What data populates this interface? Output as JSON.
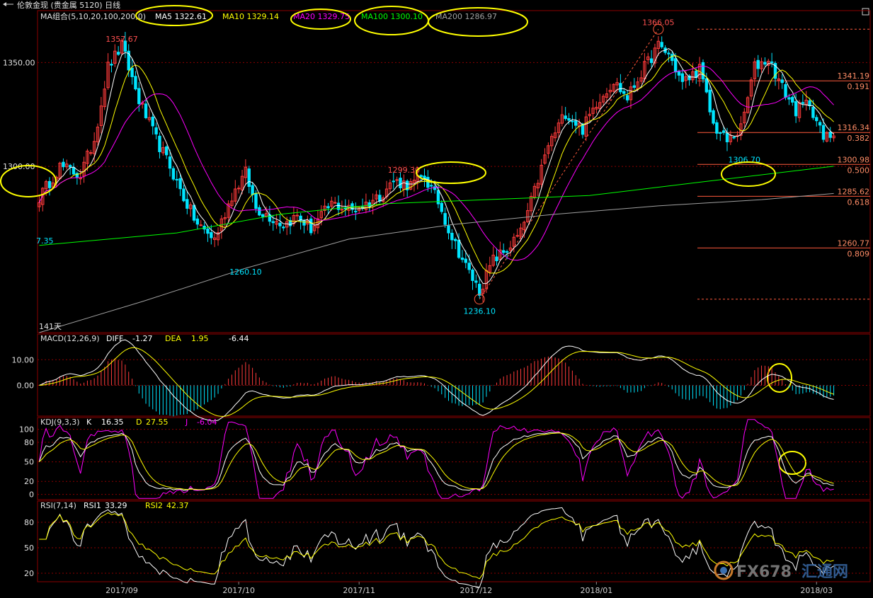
{
  "window": {
    "title": "伦敦金现 (贵金属  5120) 日线"
  },
  "colors": {
    "bg": "#000000",
    "frame": "#8b0000",
    "up": "#ff3b3b",
    "down": "#00e5ff",
    "ma5": "#ffffff",
    "ma10": "#ffff00",
    "ma20": "#ff00ff",
    "ma100": "#00ff00",
    "ma200": "#a0a0a0",
    "fib": "#ff5a3c",
    "highlight": "#ffff00"
  },
  "chart_data": {
    "type": "candlestick",
    "instrument": "伦敦金现",
    "period": "日线",
    "price_range": [
      1220,
      1375
    ],
    "price_ticks": [
      {
        "value": 1350,
        "label": "1350.00"
      },
      {
        "value": 1300,
        "label": "1300.00"
      }
    ],
    "x_labels": [
      "2017/09",
      "2017/10",
      "2017/11",
      "2017/12",
      "2018/01",
      "2018/03"
    ],
    "ma_legend": {
      "title": "MA组合(5,10,20,100,200,0)",
      "items": [
        {
          "label": "MA5 1322.61",
          "color": "#ffffff"
        },
        {
          "label": "MA10 1329.14",
          "color": "#ffff00"
        },
        {
          "label": "MA20 1329.75",
          "color": "#ff00ff"
        },
        {
          "label": "MA100 1300.10",
          "color": "#00ff00"
        },
        {
          "label": "MA200 1286.97",
          "color": "#a0a0a0"
        }
      ]
    },
    "annotations": {
      "high1": "1357.67",
      "low1": "1260.10",
      "mid_high": "1299.30",
      "low_dec": "1236.10",
      "high_jan": "1366.05",
      "low_feb": "1306.70",
      "left_edge": "7.35",
      "days": "141天"
    },
    "fib_levels": [
      {
        "price": 1341.19,
        "label": "1341.19",
        "ratio": "0.191"
      },
      {
        "price": 1316.34,
        "label": "1316.34",
        "ratio": "0.382"
      },
      {
        "price": 1300.98,
        "label": "1300.98",
        "ratio": "0.500"
      },
      {
        "price": 1285.62,
        "label": "1285.62",
        "ratio": "0.618"
      },
      {
        "price": 1260.77,
        "label": "1260.77",
        "ratio": "0.809"
      }
    ],
    "fib_top": 1366.05,
    "fib_bottom": 1236.1,
    "price_anchors": [
      [
        0,
        1285
      ],
      [
        6,
        1300
      ],
      [
        12,
        1296
      ],
      [
        16,
        1313
      ],
      [
        20,
        1348
      ],
      [
        24,
        1358
      ],
      [
        29,
        1332
      ],
      [
        34,
        1313
      ],
      [
        38,
        1300
      ],
      [
        42,
        1285
      ],
      [
        46,
        1272
      ],
      [
        51,
        1265
      ],
      [
        56,
        1286
      ],
      [
        60,
        1297
      ],
      [
        63,
        1280
      ],
      [
        67,
        1276
      ],
      [
        71,
        1272
      ],
      [
        75,
        1276
      ],
      [
        79,
        1270
      ],
      [
        85,
        1282
      ],
      [
        91,
        1279
      ],
      [
        95,
        1282
      ],
      [
        99,
        1286
      ],
      [
        103,
        1293
      ],
      [
        108,
        1291
      ],
      [
        112,
        1295
      ],
      [
        116,
        1283
      ],
      [
        120,
        1266
      ],
      [
        124,
        1252
      ],
      [
        128,
        1240
      ],
      [
        132,
        1255
      ],
      [
        136,
        1260
      ],
      [
        140,
        1268
      ],
      [
        144,
        1288
      ],
      [
        148,
        1310
      ],
      [
        153,
        1326
      ],
      [
        158,
        1318
      ],
      [
        162,
        1331
      ],
      [
        167,
        1341
      ],
      [
        171,
        1333
      ],
      [
        175,
        1345
      ],
      [
        180,
        1358
      ],
      [
        183,
        1354
      ],
      [
        187,
        1340
      ],
      [
        192,
        1347
      ],
      [
        196,
        1320
      ],
      [
        200,
        1312
      ],
      [
        204,
        1318
      ],
      [
        208,
        1348
      ],
      [
        212,
        1352
      ],
      [
        216,
        1338
      ],
      [
        220,
        1327
      ],
      [
        224,
        1331
      ],
      [
        228,
        1313
      ],
      [
        231,
        1316
      ]
    ],
    "macd": {
      "title": "MACD(12,26,9)",
      "diff_label": "DIFF",
      "diff": "-1.27",
      "dea_label": "DEA",
      "dea": "1.95",
      "macd": "-6.44",
      "range": [
        -12,
        20
      ],
      "ticks": [
        {
          "value": 10,
          "label": "10.00"
        },
        {
          "value": 0,
          "label": "0.00"
        }
      ]
    },
    "kdj": {
      "title": "KDJ(9,3,3)",
      "k_label": "K",
      "k": "16.35",
      "d_label": "D",
      "d": "27.55",
      "j_label": "J",
      "j": "-6.04",
      "range": [
        -8,
        118
      ],
      "ticks": [
        "100",
        "80",
        "50",
        "20",
        "0"
      ]
    },
    "rsi": {
      "title": "RSI(7,14)",
      "rsi1_label": "RSI1",
      "rsi1": "33.29",
      "rsi2_label": "RSI2",
      "rsi2": "42.37",
      "range": [
        10,
        105
      ],
      "ticks": [
        "80",
        "50",
        "20"
      ]
    }
  },
  "watermark": {
    "brand": "FX678",
    "name": "汇通网"
  }
}
